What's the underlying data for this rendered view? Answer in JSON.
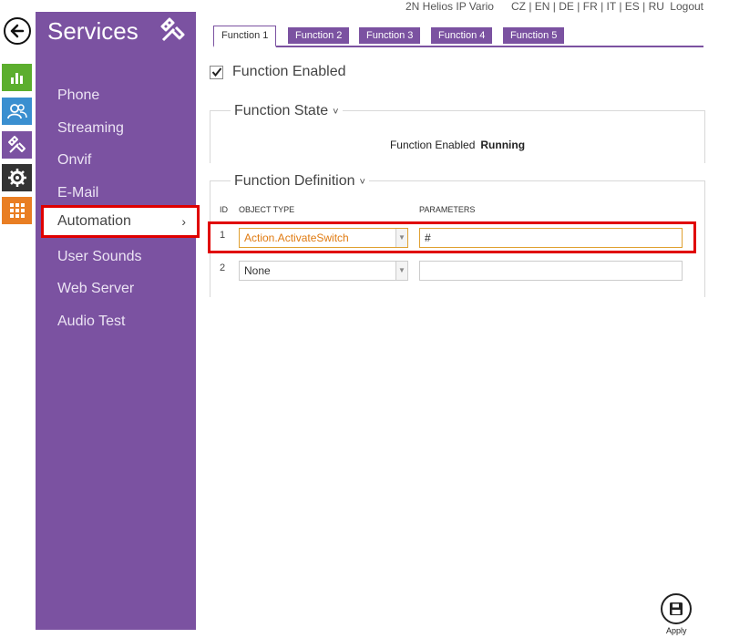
{
  "topbar": {
    "device_name": "2N Helios IP Vario",
    "languages": [
      "CZ",
      "EN",
      "DE",
      "FR",
      "IT",
      "ES",
      "RU"
    ],
    "separator": " | ",
    "logout": "Logout"
  },
  "rail": {
    "icons": [
      {
        "name": "back-icon",
        "color": "#111111"
      },
      {
        "name": "status-chart-icon",
        "color": "#5cae2e"
      },
      {
        "name": "directory-users-icon",
        "color": "#3a8fd0"
      },
      {
        "name": "services-tools-icon",
        "color": "#7b52a1"
      },
      {
        "name": "hardware-gear-icon",
        "color": "#333333"
      },
      {
        "name": "system-grid-icon",
        "color": "#e97e23"
      }
    ]
  },
  "sidebar": {
    "title": "Services",
    "items": [
      {
        "label": "Phone"
      },
      {
        "label": "Streaming"
      },
      {
        "label": "Onvif"
      },
      {
        "label": "E-Mail"
      },
      {
        "label": "Automation",
        "active": true
      },
      {
        "label": "User Sounds"
      },
      {
        "label": "Web Server"
      },
      {
        "label": "Audio Test"
      }
    ],
    "active_chevron": "›"
  },
  "tabs": [
    "Function 1",
    "Function 2",
    "Function 3",
    "Function 4",
    "Function 5"
  ],
  "function_enabled": {
    "label": "Function Enabled",
    "checked": true
  },
  "function_state": {
    "legend": "Function State",
    "caret": "˅",
    "state_label": "Function Enabled",
    "state_value": "Running"
  },
  "function_definition": {
    "legend": "Function Definition",
    "caret": "˅",
    "columns": {
      "id": "ID",
      "object_type": "OBJECT TYPE",
      "parameters": "PARAMETERS"
    },
    "rows": [
      {
        "id": "1",
        "object_type": "Action.ActivateSwitch",
        "parameters": "#"
      },
      {
        "id": "2",
        "object_type": "None",
        "parameters": ""
      }
    ]
  },
  "apply": {
    "label": "Apply"
  },
  "colors": {
    "accent": "#7b52a1",
    "highlight": "#e00000",
    "orange_text": "#e07a10"
  }
}
